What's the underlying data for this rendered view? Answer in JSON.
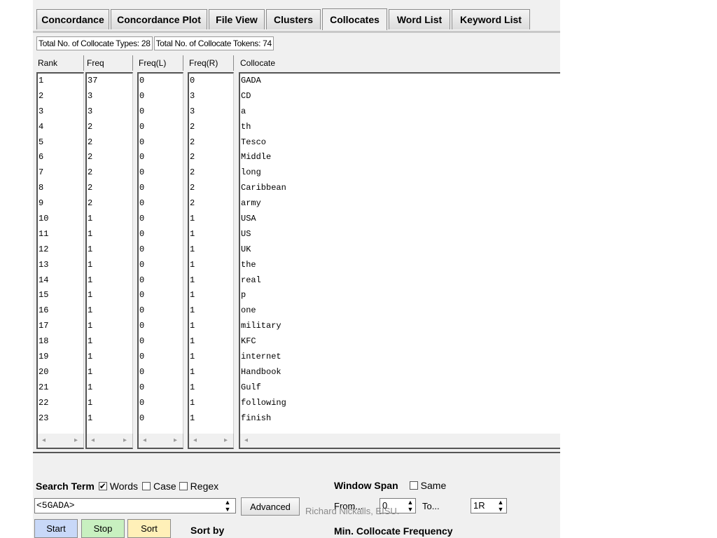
{
  "tabs": [
    {
      "label": "Concordance"
    },
    {
      "label": "Concordance Plot"
    },
    {
      "label": "File View"
    },
    {
      "label": "Clusters"
    },
    {
      "label": "Collocates"
    },
    {
      "label": "Word List"
    },
    {
      "label": "Keyword List"
    }
  ],
  "active_tab": "Collocates",
  "totals": {
    "types": "Total No. of Collocate Types: 28",
    "tokens": "Total No. of Collocate Tokens: 74"
  },
  "columns": {
    "rank": "Rank",
    "freq": "Freq",
    "freq_l": "Freq(L)",
    "freq_r": "Freq(R)",
    "collocate": "Collocate"
  },
  "rows": [
    {
      "rank": "1",
      "freq": "37",
      "freq_l": "0",
      "freq_r": "0",
      "collocate": "GADA"
    },
    {
      "rank": "2",
      "freq": "3",
      "freq_l": "0",
      "freq_r": "3",
      "collocate": "CD"
    },
    {
      "rank": "3",
      "freq": "3",
      "freq_l": "0",
      "freq_r": "3",
      "collocate": "a"
    },
    {
      "rank": "4",
      "freq": "2",
      "freq_l": "0",
      "freq_r": "2",
      "collocate": "th"
    },
    {
      "rank": "5",
      "freq": "2",
      "freq_l": "0",
      "freq_r": "2",
      "collocate": "Tesco"
    },
    {
      "rank": "6",
      "freq": "2",
      "freq_l": "0",
      "freq_r": "2",
      "collocate": "Middle"
    },
    {
      "rank": "7",
      "freq": "2",
      "freq_l": "0",
      "freq_r": "2",
      "collocate": "long"
    },
    {
      "rank": "8",
      "freq": "2",
      "freq_l": "0",
      "freq_r": "2",
      "collocate": "Caribbean"
    },
    {
      "rank": "9",
      "freq": "2",
      "freq_l": "0",
      "freq_r": "2",
      "collocate": "army"
    },
    {
      "rank": "10",
      "freq": "1",
      "freq_l": "0",
      "freq_r": "1",
      "collocate": "USA"
    },
    {
      "rank": "11",
      "freq": "1",
      "freq_l": "0",
      "freq_r": "1",
      "collocate": "US"
    },
    {
      "rank": "12",
      "freq": "1",
      "freq_l": "0",
      "freq_r": "1",
      "collocate": "UK"
    },
    {
      "rank": "13",
      "freq": "1",
      "freq_l": "0",
      "freq_r": "1",
      "collocate": "the"
    },
    {
      "rank": "14",
      "freq": "1",
      "freq_l": "0",
      "freq_r": "1",
      "collocate": "real"
    },
    {
      "rank": "15",
      "freq": "1",
      "freq_l": "0",
      "freq_r": "1",
      "collocate": "p"
    },
    {
      "rank": "16",
      "freq": "1",
      "freq_l": "0",
      "freq_r": "1",
      "collocate": "one"
    },
    {
      "rank": "17",
      "freq": "1",
      "freq_l": "0",
      "freq_r": "1",
      "collocate": "military"
    },
    {
      "rank": "18",
      "freq": "1",
      "freq_l": "0",
      "freq_r": "1",
      "collocate": "KFC"
    },
    {
      "rank": "19",
      "freq": "1",
      "freq_l": "0",
      "freq_r": "1",
      "collocate": "internet"
    },
    {
      "rank": "20",
      "freq": "1",
      "freq_l": "0",
      "freq_r": "1",
      "collocate": "Handbook"
    },
    {
      "rank": "21",
      "freq": "1",
      "freq_l": "0",
      "freq_r": "1",
      "collocate": "Gulf"
    },
    {
      "rank": "22",
      "freq": "1",
      "freq_l": "0",
      "freq_r": "1",
      "collocate": "following"
    },
    {
      "rank": "23",
      "freq": "1",
      "freq_l": "0",
      "freq_r": "1",
      "collocate": "finish"
    }
  ],
  "search": {
    "label": "Search Term",
    "words_label": "Words",
    "words_checked": true,
    "case_label": "Case",
    "case_checked": false,
    "regex_label": "Regex",
    "regex_checked": false,
    "term": "<5GADA>",
    "advanced_label": "Advanced"
  },
  "buttons": {
    "start": "Start",
    "stop": "Stop",
    "sort": "Sort"
  },
  "sort_by_label": "Sort by",
  "window_span": {
    "label": "Window Span",
    "same_label": "Same",
    "same_checked": false,
    "from_label": "From...",
    "from_value": "0",
    "to_label": "To...",
    "to_value": "1R"
  },
  "min_collocate_frequency_label": "Min. Collocate Frequency",
  "watermark": "Richard Nickalls, EISU.",
  "colors": {
    "start_button": "#c8d8f8",
    "stop_button": "#c8f0c0",
    "sort_button": "#fff0b8"
  }
}
